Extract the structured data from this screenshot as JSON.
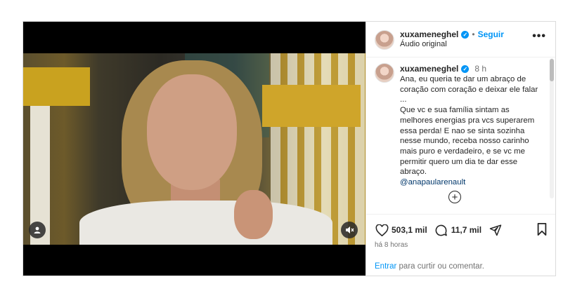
{
  "post": {
    "username": "xuxameneghel",
    "verified_icon": "✓",
    "dot": "•",
    "follow_label": "Seguir",
    "audio_label": "Áudio original",
    "more_label": "•••"
  },
  "caption": {
    "username": "xuxameneghel",
    "time": "8 h",
    "text": "Ana, eu queria te dar um abraço de coração com coração e deixar ele falar ...\nQue vc e sua família sintam as melhores energias pra vcs superarem essa perda! E nao se sinta sozinha nesse mundo, receba nosso carinho mais puro e verdadeiro,  e se vc me permitir quero um dia te dar esse abraço.",
    "mention": "@anapaularenault",
    "add_icon": "+"
  },
  "actions": {
    "likes": "503,1 mil",
    "comments": "11,7 mil",
    "time_ago": "há 8 horas",
    "login_link": "Entrar",
    "login_text": " para curtir ou comentar."
  },
  "icons": {
    "heart": "heart-icon",
    "comment": "comment-icon",
    "share": "share-icon",
    "save": "bookmark-icon",
    "user_tag": "user-tag-icon",
    "mute": "speaker-muted-icon"
  },
  "colors": {
    "accent": "#0095f6",
    "mention": "#00376b",
    "muted_text": "#737373"
  }
}
